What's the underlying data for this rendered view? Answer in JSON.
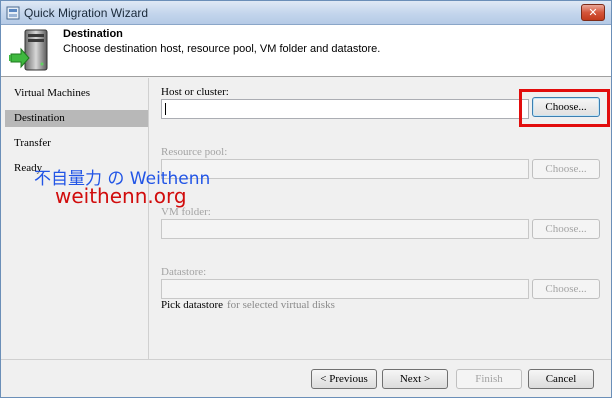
{
  "window": {
    "title": "Quick Migration Wizard",
    "close_glyph": "✕",
    "icon": "wizard-icon"
  },
  "header": {
    "title": "Destination",
    "description": "Choose destination host, resource pool, VM folder and datastore.",
    "icon": "server-migration-icon"
  },
  "sidebar": {
    "steps": [
      {
        "label": "Virtual Machines",
        "active": false
      },
      {
        "label": "Destination",
        "active": true
      },
      {
        "label": "Transfer",
        "active": false
      },
      {
        "label": "Ready",
        "active": false
      }
    ]
  },
  "form": {
    "host": {
      "label": "Host or cluster:",
      "value": "",
      "button": "Choose...",
      "enabled": true,
      "highlighted": true
    },
    "pool": {
      "label": "Resource pool:",
      "value": "",
      "button": "Choose...",
      "enabled": false
    },
    "folder": {
      "label": "VM folder:",
      "value": "",
      "button": "Choose...",
      "enabled": false
    },
    "datastore": {
      "label": "Datastore:",
      "value": "",
      "button": "Choose...",
      "enabled": false
    },
    "pick_datastore": {
      "label": "Pick datastore",
      "sublabel": "for selected virtual disks"
    }
  },
  "footer": {
    "previous": "< Previous",
    "next": "Next >",
    "finish": "Finish",
    "cancel": "Cancel"
  },
  "watermark": {
    "line1": "不自量力 の Weithenn",
    "line2": "weithenn.org"
  },
  "colors": {
    "highlight": "#e20d0d",
    "watermark_blue": "#2255e6",
    "watermark_red": "#d10c0c",
    "active_step": "#b8b8b8"
  }
}
